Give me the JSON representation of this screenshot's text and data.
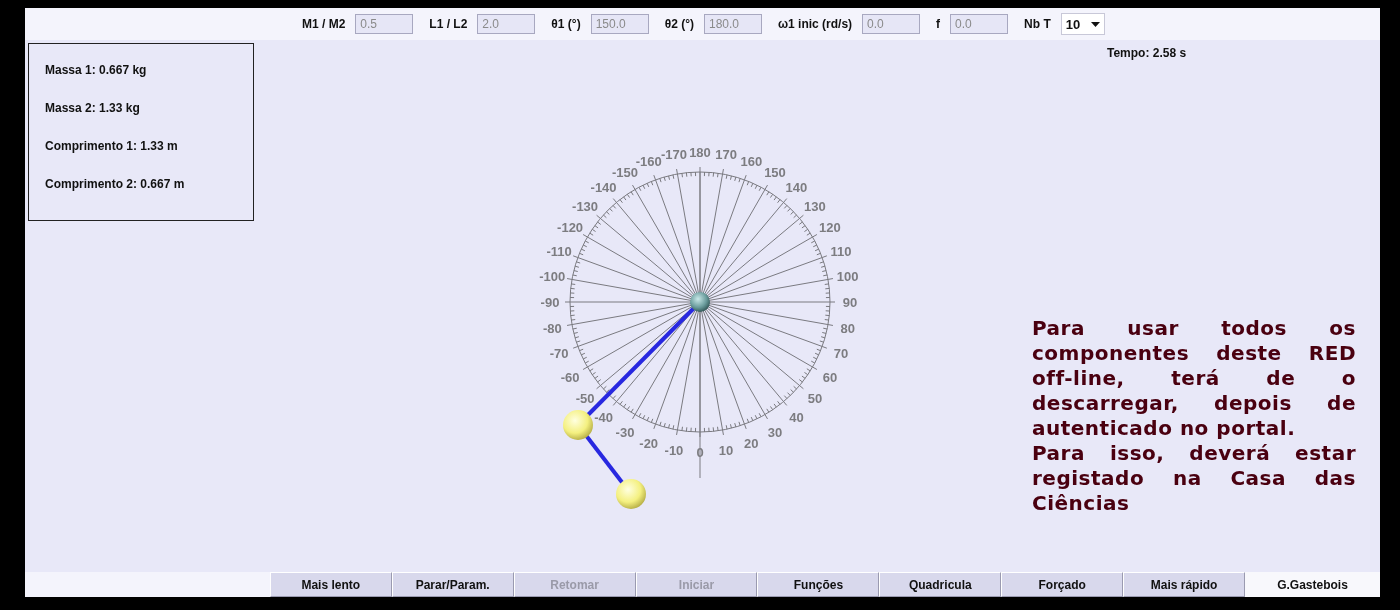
{
  "toolbar": {
    "fields": [
      {
        "label": "M1 / M2",
        "value": "0.5",
        "disabled": true
      },
      {
        "label": "L1 / L2",
        "value": "2.0",
        "disabled": true
      },
      {
        "label": "θ1 (°)",
        "value": "150.0",
        "disabled": true
      },
      {
        "label": "θ2 (°)",
        "value": "180.0",
        "disabled": true
      },
      {
        "label": "ω1 inic (rd/s)",
        "value": "0.0",
        "disabled": true
      },
      {
        "label": "f",
        "value": "0.0",
        "disabled": true
      }
    ],
    "select": {
      "label": "Nb T",
      "value": "10"
    }
  },
  "info": [
    "Massa 1: 0.667 kg",
    "Massa 2: 1.33 kg",
    "Comprimento 1: 1.33 m",
    "Comprimento 2: 0.667 m"
  ],
  "time": "Tempo: 2.58 s",
  "dial": {
    "left_labels": [
      "-170",
      "-160",
      "-150",
      "-140",
      "-130",
      "-120",
      "-110",
      "-100",
      "-90",
      "-80",
      "-70",
      "-60",
      "-50",
      "-40",
      "-30",
      "-20",
      "-10"
    ],
    "right_labels": [
      "180",
      "170",
      "160",
      "150",
      "140",
      "130",
      "120",
      "110",
      "100",
      "90",
      "80",
      "70",
      "60",
      "50",
      "40",
      "30",
      "20",
      "10",
      "0"
    ]
  },
  "notice": [
    "Para usar todos os componentes deste RED off-line, terá de o descarregar, depois de autenticado no portal.",
    "Para isso, deverá estar registado na Casa das Ciências"
  ],
  "buttons": [
    {
      "label": "Mais lento",
      "disabled": false,
      "kind": "button"
    },
    {
      "label": "Parar/Param.",
      "disabled": false,
      "kind": "button"
    },
    {
      "label": "Retomar",
      "disabled": true,
      "kind": "button"
    },
    {
      "label": "Iniciar",
      "disabled": true,
      "kind": "button"
    },
    {
      "label": "Funções",
      "disabled": false,
      "kind": "button"
    },
    {
      "label": "Quadricula",
      "disabled": false,
      "kind": "button"
    },
    {
      "label": "Forçado",
      "disabled": false,
      "kind": "button"
    },
    {
      "label": "Mais rápido",
      "disabled": false,
      "kind": "button"
    },
    {
      "label": "G.Gastebois",
      "disabled": false,
      "kind": "credit"
    }
  ]
}
